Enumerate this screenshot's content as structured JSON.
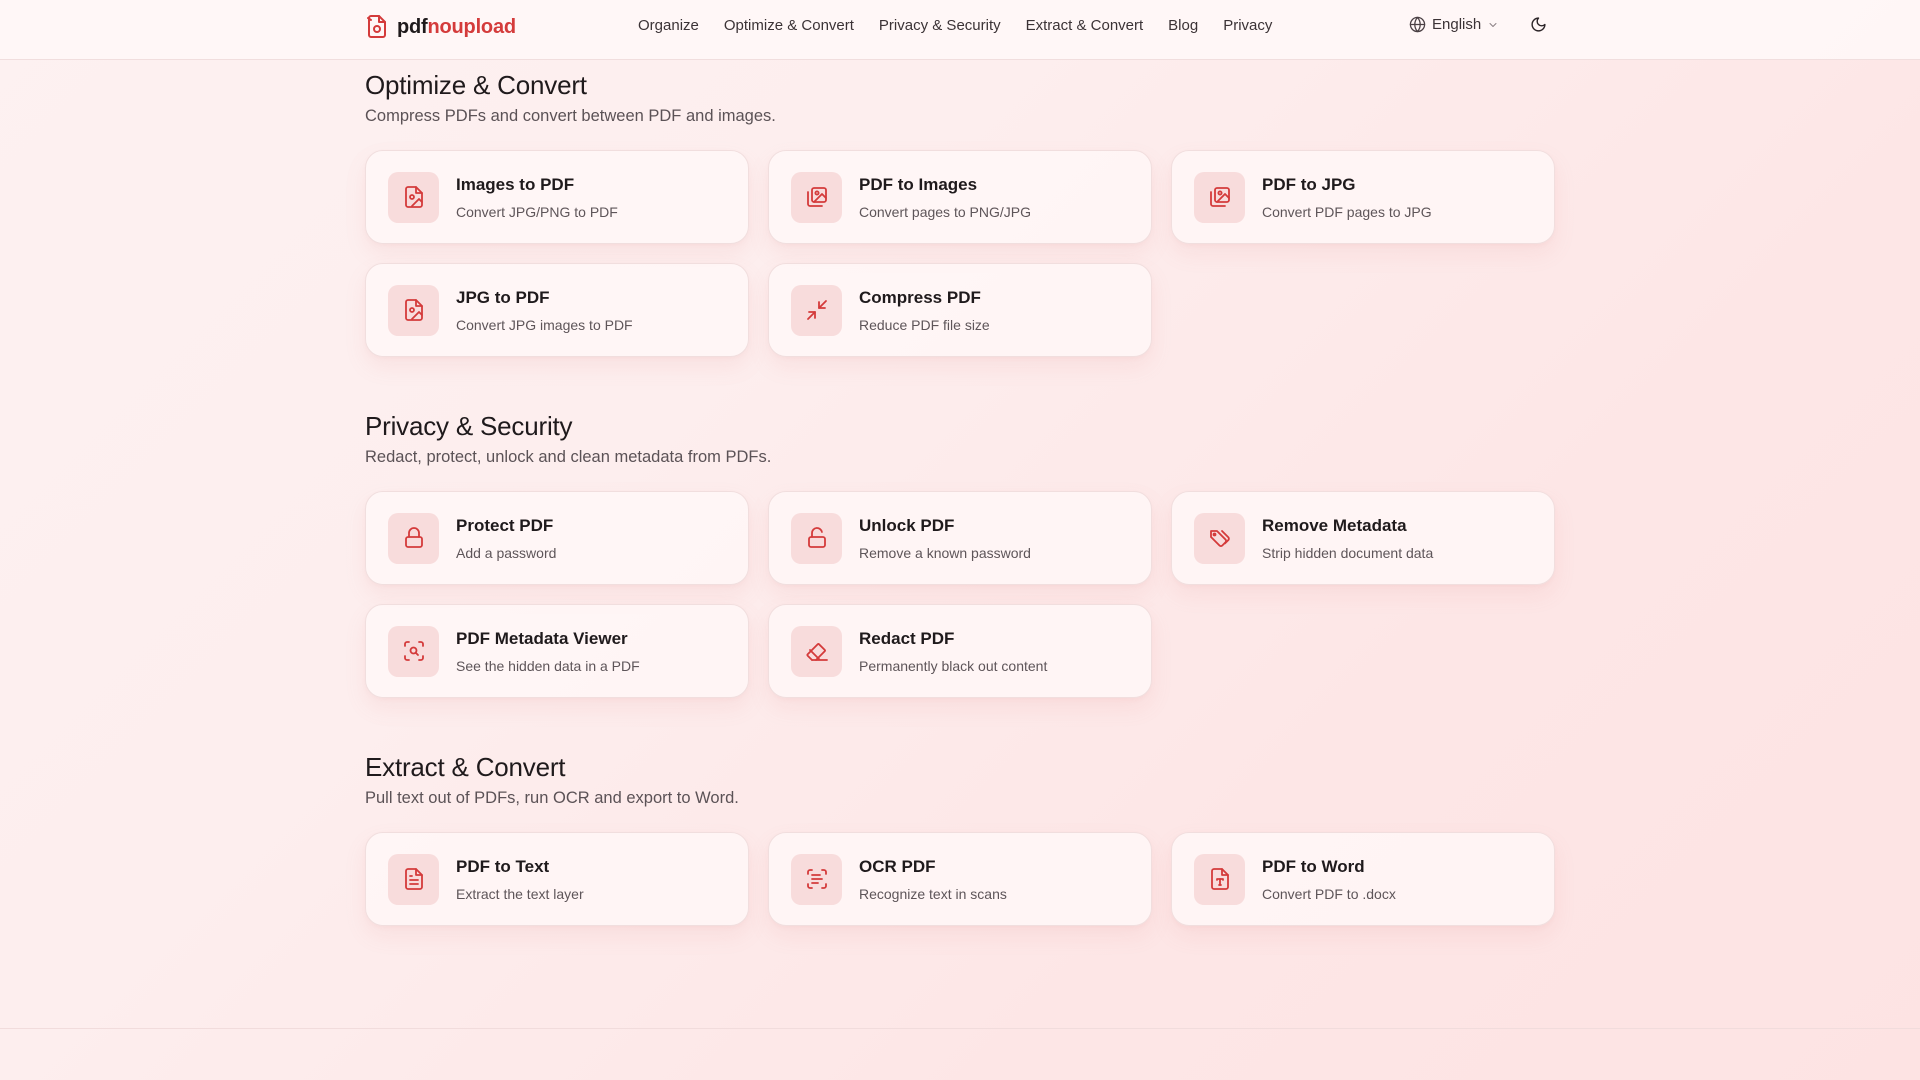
{
  "header": {
    "logo": {
      "part1": "pdf",
      "part2": "noupload"
    },
    "nav": [
      "Organize",
      "Optimize & Convert",
      "Privacy & Security",
      "Extract & Convert",
      "Blog",
      "Privacy"
    ],
    "language": "English"
  },
  "colors": {
    "accent": "#d43b3b",
    "icon_bg": "#f8dcdc"
  },
  "sections": [
    {
      "title": "Optimize & Convert",
      "subtitle": "Compress PDFs and convert between PDF and images.",
      "tools": [
        {
          "title": "Images to PDF",
          "desc": "Convert JPG/PNG to PDF",
          "icon": "file-image-icon"
        },
        {
          "title": "PDF to Images",
          "desc": "Convert pages to PNG/JPG",
          "icon": "images-icon"
        },
        {
          "title": "PDF to JPG",
          "desc": "Convert PDF pages to JPG",
          "icon": "images-icon"
        },
        {
          "title": "JPG to PDF",
          "desc": "Convert JPG images to PDF",
          "icon": "file-image-icon"
        },
        {
          "title": "Compress PDF",
          "desc": "Reduce PDF file size",
          "icon": "minimize-icon"
        }
      ]
    },
    {
      "title": "Privacy & Security",
      "subtitle": "Redact, protect, unlock and clean metadata from PDFs.",
      "tools": [
        {
          "title": "Protect PDF",
          "desc": "Add a password",
          "icon": "lock-icon"
        },
        {
          "title": "Unlock PDF",
          "desc": "Remove a known password",
          "icon": "unlock-icon"
        },
        {
          "title": "Remove Metadata",
          "desc": "Strip hidden document data",
          "icon": "tags-icon"
        },
        {
          "title": "PDF Metadata Viewer",
          "desc": "See the hidden data in a PDF",
          "icon": "scan-search-icon"
        },
        {
          "title": "Redact PDF",
          "desc": "Permanently black out content",
          "icon": "eraser-icon"
        }
      ]
    },
    {
      "title": "Extract & Convert",
      "subtitle": "Pull text out of PDFs, run OCR and export to Word.",
      "tools": [
        {
          "title": "PDF to Text",
          "desc": "Extract the text layer",
          "icon": "file-text-icon"
        },
        {
          "title": "OCR PDF",
          "desc": "Recognize text in scans",
          "icon": "scan-text-icon"
        },
        {
          "title": "PDF to Word",
          "desc": "Convert PDF to .docx",
          "icon": "file-type-icon"
        }
      ]
    }
  ]
}
